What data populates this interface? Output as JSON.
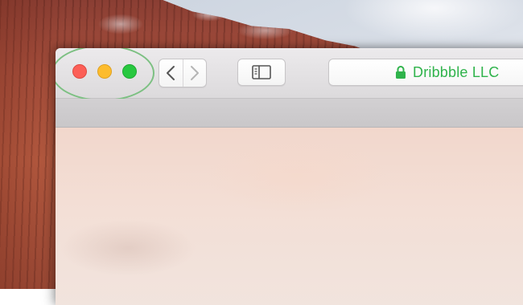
{
  "browser": {
    "window_controls": {
      "close": "close-button",
      "minimize": "minimize-button",
      "zoom": "zoom-button",
      "highlight_color": "#7cc082"
    },
    "toolbar": {
      "back_icon": "chevron-left-icon",
      "forward_icon": "chevron-right-icon",
      "sidebar_icon": "sidebar-icon"
    },
    "address_bar": {
      "lock_icon": "lock-icon",
      "text": "Dribbble LLC",
      "text_color": "#2fb34b"
    }
  }
}
